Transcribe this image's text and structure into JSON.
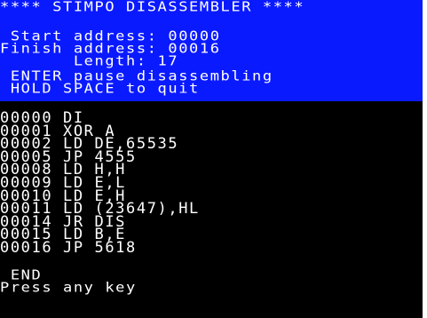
{
  "colors": {
    "banner": "#0a1aff",
    "screen": "#000000",
    "text": "#ffffff"
  },
  "header": {
    "title": "**** STIMPO DISASSEMBLER ****",
    "start_line": " Start address: 00000",
    "finish_line": "Finish address: 00016",
    "length_line": "       Length: 17",
    "enter_hint": " ENTER pause disassembling",
    "space_hint": " HOLD SPACE to quit"
  },
  "listing": [
    "00000 DI",
    "00001 XOR A",
    "00002 LD DE,65535",
    "00005 JP 4555",
    "00008 LD H,H",
    "00009 LD E,L",
    "00010 LD E,H",
    "00011 LD (23647),HL",
    "00014 JR DIS",
    "00015 LD B,E",
    "00016 JP 5618"
  ],
  "footer": {
    "end_label": " END",
    "prompt": "Press any key"
  }
}
